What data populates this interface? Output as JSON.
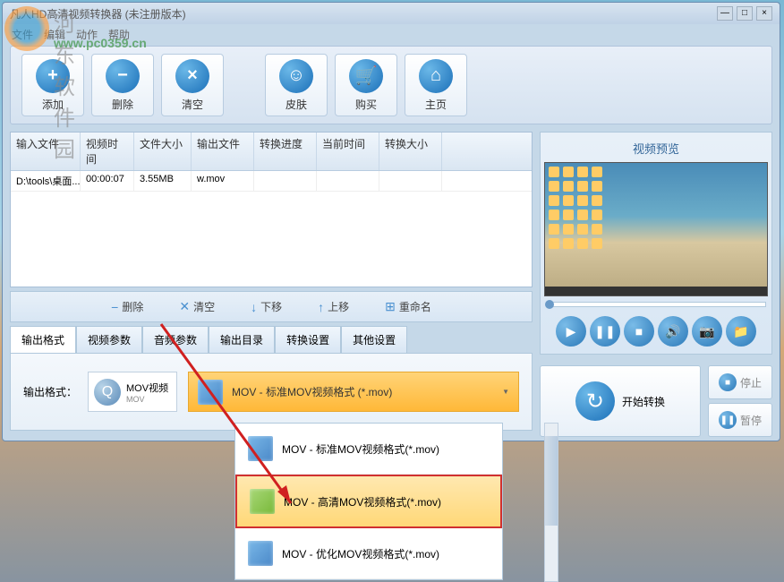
{
  "watermark": {
    "text": "河东软件园",
    "url": "www.pc0359.cn"
  },
  "window": {
    "title": "凡人HD高清视频转换器    (未注册版本)"
  },
  "menu": {
    "file": "文件",
    "edit": "编辑",
    "action": "动作",
    "help": "帮助"
  },
  "toolbar": {
    "add": "添加",
    "delete": "删除",
    "clear": "清空",
    "skin": "皮肤",
    "buy": "购买",
    "home": "主页"
  },
  "table": {
    "headers": {
      "input": "输入文件",
      "time": "视频时间",
      "size": "文件大小",
      "output": "输出文件",
      "progress": "转换进度",
      "current": "当前时间",
      "conv": "转换大小"
    },
    "rows": [
      {
        "input": "D:\\tools\\桌面...",
        "time": "00:00:07",
        "size": "3.55MB",
        "output": "w.mov",
        "progress": "",
        "current": "",
        "conv": ""
      }
    ]
  },
  "actions": {
    "delete": "删除",
    "clear": "清空",
    "down": "下移",
    "up": "上移",
    "rename": "重命名"
  },
  "tabs": {
    "format": "输出格式",
    "video": "视频参数",
    "audio": "音频参数",
    "dir": "输出目录",
    "convert": "转换设置",
    "other": "其他设置"
  },
  "output": {
    "label": "输出格式：",
    "format_name": "MOV视频",
    "format_sub": "MOV",
    "selected": "MOV - 标准MOV视频格式 (*.mov)",
    "options": [
      {
        "label": "MOV - 标准MOV视频格式(*.mov)",
        "highlighted": false
      },
      {
        "label": "MOV - 高清MOV视频格式(*.mov)",
        "highlighted": true
      },
      {
        "label": "MOV - 优化MOV视频格式(*.mov)",
        "highlighted": false
      }
    ]
  },
  "preview": {
    "title": "视频预览"
  },
  "convert": {
    "start": "开始转换",
    "stop": "停止",
    "pause": "暂停"
  }
}
